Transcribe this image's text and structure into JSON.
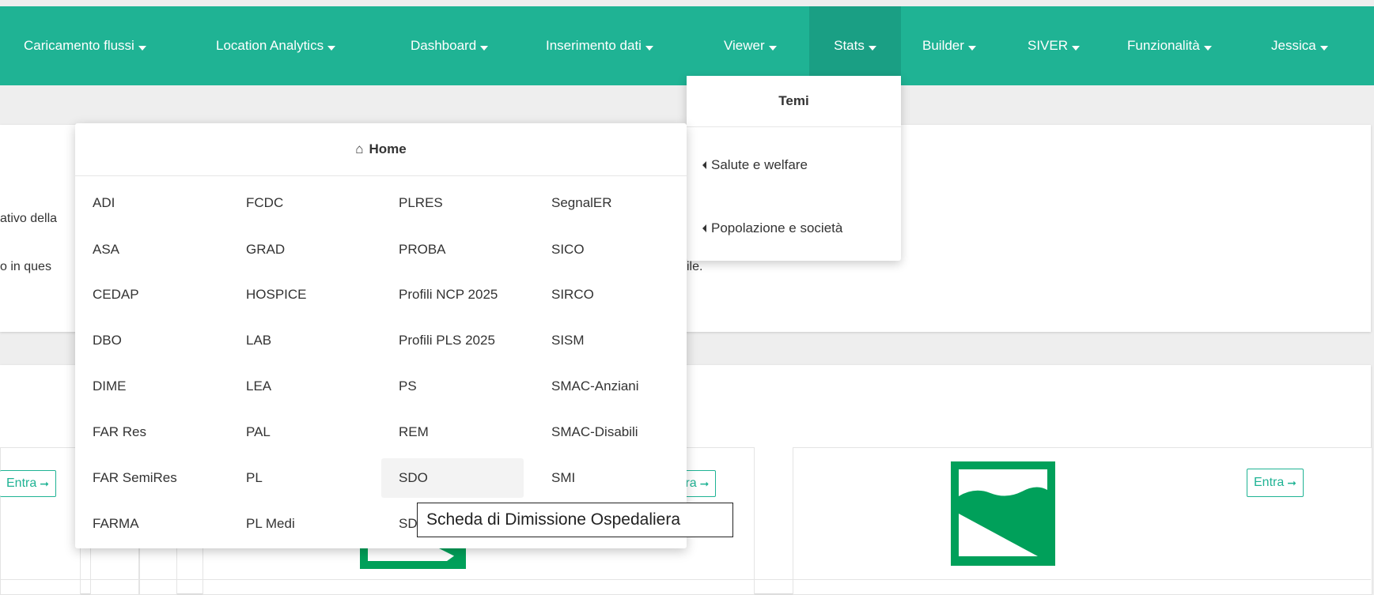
{
  "nav": {
    "items": [
      {
        "label": "Caricamento flussi"
      },
      {
        "label": "Location Analytics"
      },
      {
        "label": "Dashboard"
      },
      {
        "label": "Inserimento dati"
      },
      {
        "label": "Viewer"
      },
      {
        "label": "Stats"
      },
      {
        "label": "Builder"
      },
      {
        "label": "SIVER"
      },
      {
        "label": "Funzionalità"
      },
      {
        "label": "Jessica"
      }
    ]
  },
  "stats_menu": {
    "header": "Temi",
    "items": [
      {
        "label": "Salute e welfare"
      },
      {
        "label": "Popolazione e società"
      }
    ]
  },
  "home_menu": {
    "header": "Home",
    "columns": [
      [
        "ADI",
        "ASA",
        "CEDAP",
        "DBO",
        "DIME",
        "FAR Res",
        "FAR SemiRes",
        "FARMA"
      ],
      [
        "FCDC",
        "GRAD",
        "HOSPICE",
        "LAB",
        "LEA",
        "PAL",
        "PL",
        "PL Medi"
      ],
      [
        "PLRES",
        "PROBA",
        "Profili NCP 2025",
        "Profili PLS 2025",
        "PS",
        "REM",
        "SDO",
        "SD"
      ],
      [
        "SegnalER",
        "SICO",
        "SIRCO",
        "SISM",
        "SMAC-Anziani",
        "SMAC-Disabili",
        "SMI",
        ""
      ]
    ]
  },
  "tooltip": {
    "text": "Scheda di Dimissione Ospedaliera"
  },
  "background": {
    "text1": "ativo della",
    "text2": "o in ques",
    "text3": "ile.",
    "entra_left": "Entra",
    "entra_mid": "tra",
    "entra_right": "Entra"
  },
  "colors": {
    "brand": "#1fb394",
    "brand_dark": "#1a9f84",
    "logo_green": "#00a05a"
  }
}
